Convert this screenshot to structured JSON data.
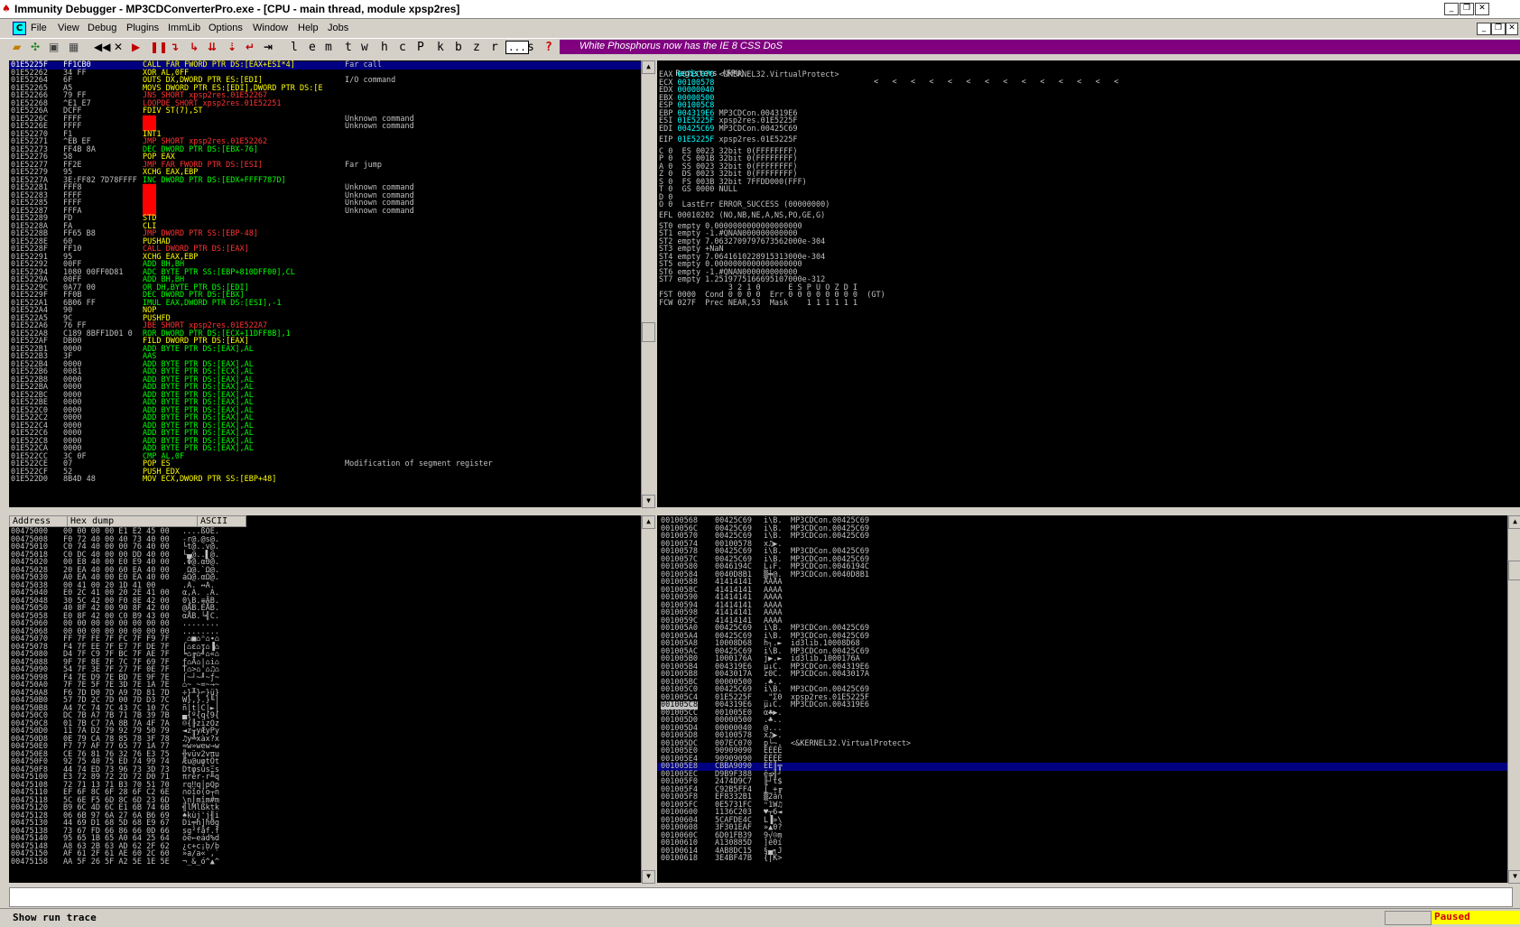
{
  "window": {
    "title": "Immunity Debugger - MP3CDConverterPro.exe - [CPU - main thread, module xpsp2res]"
  },
  "menu": [
    "File",
    "View",
    "Debug",
    "Plugins",
    "ImmLib",
    "Options",
    "Window",
    "Help",
    "Jobs"
  ],
  "toolbar": {
    "letters": [
      "l",
      "e",
      "m",
      "t",
      "w",
      "h",
      "c",
      "P",
      "k",
      "b",
      "z",
      "r",
      "...",
      "s",
      "?"
    ],
    "banner": "White Phosphorus now has the IE 8 CSS DoS"
  },
  "disasm": {
    "rows": [
      [
        "01E5225F",
        "FF1CB0",
        "CALL FAR FWORD PTR DS:[EAX+ESI*4]",
        "Far call",
        "sel"
      ],
      [
        "01E52262",
        "34 FF",
        "XOR AL,0FF",
        "",
        ""
      ],
      [
        "01E52264",
        "6F",
        "OUTS DX,DWORD PTR ES:[EDI]",
        "I/O command",
        ""
      ],
      [
        "01E52265",
        "A5",
        "MOVS DWORD PTR ES:[EDI],DWORD PTR DS:[E",
        "",
        ""
      ],
      [
        "01E52266",
        "79 FF",
        "JNS SHORT xpsp2res.01E52267",
        "",
        "j"
      ],
      [
        "01E52268",
        "^E1 E7",
        "LOOPDE SHORT xpsp2res.01E52251",
        "",
        "j"
      ],
      [
        "01E5226A",
        "DCFF",
        "FDIV ST(7),ST",
        "",
        ""
      ],
      [
        "01E5226C",
        "FFFF",
        "???",
        "Unknown command",
        "u"
      ],
      [
        "01E5226E",
        "FFFF",
        "???",
        "Unknown command",
        "u"
      ],
      [
        "01E52270",
        "F1",
        "INT1",
        "",
        ""
      ],
      [
        "01E52271",
        "^EB EF",
        "JMP SHORT xpsp2res.01E52262",
        "",
        "j"
      ],
      [
        "01E52273",
        "FF4B 8A",
        "DEC DWORD PTR DS:[EBX-76]",
        "",
        ""
      ],
      [
        "01E52276",
        "58",
        "POP EAX",
        "",
        ""
      ],
      [
        "01E52277",
        "FF2E",
        "JMP FAR FWORD PTR DS:[ESI]",
        "Far jump",
        "j"
      ],
      [
        "01E52279",
        "95",
        "XCHG EAX,EBP",
        "",
        ""
      ],
      [
        "01E5227A",
        "3E:FF82 7D78FFFF",
        "INC DWORD PTR DS:[EDX+FFFF787D]",
        "",
        ""
      ],
      [
        "01E52281",
        "FFF8",
        "???",
        "Unknown command",
        "u"
      ],
      [
        "01E52283",
        "FFFF",
        "???",
        "Unknown command",
        "u"
      ],
      [
        "01E52285",
        "FFFF",
        "???",
        "Unknown command",
        "u"
      ],
      [
        "01E52287",
        "FFFA",
        "???",
        "Unknown command",
        "u"
      ],
      [
        "01E52289",
        "FD",
        "STD",
        "",
        ""
      ],
      [
        "01E5228A",
        "FA",
        "CLI",
        "",
        ""
      ],
      [
        "01E5228B",
        "FF65 B8",
        "JMP DWORD PTR SS:[EBP-48]",
        "",
        "j"
      ],
      [
        "01E5228E",
        "60",
        "PUSHAD",
        "",
        ""
      ],
      [
        "01E5228F",
        "FF10",
        "CALL DWORD PTR DS:[EAX]",
        "",
        "c"
      ],
      [
        "01E52291",
        "95",
        "XCHG EAX,EBP",
        "",
        ""
      ],
      [
        "01E52292",
        "00FF",
        "ADD BH,BH",
        "",
        ""
      ],
      [
        "01E52294",
        "1080 00FF0D81",
        "ADC BYTE PTR SS:[EBP+810DFF00],CL",
        "",
        ""
      ],
      [
        "01E5229A",
        "00FF",
        "ADD BH,BH",
        "",
        ""
      ],
      [
        "01E5229C",
        "0A77 00",
        "OR DH,BYTE PTR DS:[EDI]",
        "",
        ""
      ],
      [
        "01E5229F",
        "FF0B",
        "DEC DWORD PTR DS:[EBX]",
        "",
        ""
      ],
      [
        "01E522A1",
        "6B06 FF",
        "IMUL EAX,DWORD PTR DS:[ESI],-1",
        "",
        ""
      ],
      [
        "01E522A4",
        "90",
        "NOP",
        "",
        ""
      ],
      [
        "01E522A5",
        "9C",
        "PUSHFD",
        "",
        ""
      ],
      [
        "01E522A6",
        "76 FF",
        "JBE SHORT xpsp2res.01E522A7",
        "",
        "j"
      ],
      [
        "01E522A8",
        "C189 8BFF1D01 0",
        "ROR DWORD PTR DS:[ECX+11DFF8B],1",
        "",
        ""
      ],
      [
        "01E522AF",
        "DB00",
        "FILD DWORD PTR DS:[EAX]",
        "",
        ""
      ],
      [
        "01E522B1",
        "0000",
        "ADD BYTE PTR DS:[EAX],AL",
        "",
        ""
      ],
      [
        "01E522B3",
        "3F",
        "AAS",
        "",
        ""
      ],
      [
        "01E522B4",
        "0000",
        "ADD BYTE PTR DS:[EAX],AL",
        "",
        ""
      ],
      [
        "01E522B6",
        "0081",
        "ADD BYTE PTR DS:[ECX],AL",
        "",
        ""
      ],
      [
        "01E522B8",
        "0000",
        "ADD BYTE PTR DS:[EAX],AL",
        "",
        ""
      ],
      [
        "01E522BA",
        "0000",
        "ADD BYTE PTR DS:[EAX],AL",
        "",
        ""
      ],
      [
        "01E522BC",
        "0000",
        "ADD BYTE PTR DS:[EAX],AL",
        "",
        ""
      ],
      [
        "01E522BE",
        "0000",
        "ADD BYTE PTR DS:[EAX],AL",
        "",
        ""
      ],
      [
        "01E522C0",
        "0000",
        "ADD BYTE PTR DS:[EAX],AL",
        "",
        ""
      ],
      [
        "01E522C2",
        "0000",
        "ADD BYTE PTR DS:[EAX],AL",
        "",
        ""
      ],
      [
        "01E522C4",
        "0000",
        "ADD BYTE PTR DS:[EAX],AL",
        "",
        ""
      ],
      [
        "01E522C6",
        "0000",
        "ADD BYTE PTR DS:[EAX],AL",
        "",
        ""
      ],
      [
        "01E522C8",
        "0000",
        "ADD BYTE PTR DS:[EAX],AL",
        "",
        ""
      ],
      [
        "01E522CA",
        "0000",
        "ADD BYTE PTR DS:[EAX],AL",
        "",
        ""
      ],
      [
        "01E522CC",
        "3C 0F",
        "CMP AL,0F",
        "",
        ""
      ],
      [
        "01E522CE",
        "07",
        "POP ES",
        "Modification of segment register",
        ""
      ],
      [
        "01E522CF",
        "52",
        "PUSH EDX",
        "",
        ""
      ],
      [
        "01E522D0",
        "8B4D 48",
        "MOV ECX,DWORD PTR SS:[EBP+48]",
        "",
        ""
      ]
    ]
  },
  "registers": {
    "header": "Registers (FPU)",
    "lines": [
      [
        "EAX",
        "007EC070",
        "<&KERNEL32.VirtualProtect>"
      ],
      [
        "ECX",
        "00100578",
        ""
      ],
      [
        "EDX",
        "00000040",
        ""
      ],
      [
        "EBX",
        "00000500",
        ""
      ],
      [
        "ESP",
        "001005C8",
        ""
      ],
      [
        "EBP",
        "004319E6",
        "MP3CDCon.004319E6"
      ],
      [
        "ESI",
        "01E5225F",
        "xpsp2res.01E5225F"
      ],
      [
        "EDI",
        "00425C69",
        "MP3CDCon.00425C69"
      ],
      [
        "",
        "",
        " "
      ],
      [
        "EIP",
        "01E5225F",
        "xpsp2res.01E5225F"
      ]
    ],
    "flags": [
      "C 0  ES 0023 32bit 0(FFFFFFFF)",
      "P 0  CS 001B 32bit 0(FFFFFFFF)",
      "A 0  SS 0023 32bit 0(FFFFFFFF)",
      "Z 0  DS 0023 32bit 0(FFFFFFFF)",
      "S 0  FS 003B 32bit 7FFDD000(FFF)",
      "T 0  GS 0000 NULL",
      "D 0",
      "O 0  LastErr ERROR_SUCCESS (00000000)"
    ],
    "efl": "EFL 00010202 (NO,NB,NE,A,NS,PO,GE,G)",
    "fpu": [
      "ST0 empty 0.0000000000000000000",
      "ST1 empty -1.#QNAN000000000000",
      "ST2 empty 7.0632709797673562000e-304",
      "ST3 empty +NaN",
      "ST4 empty 7.0641610228915313000e-304",
      "ST5 empty 0.0000000000000000000",
      "ST6 empty -1.#QNAN000000000000",
      "ST7 empty 1.2519775166695107000e-312",
      "               3 2 1 0      E S P U O Z D I",
      "FST 0000  Cond 0 0 0 0  Err 0 0 0 0 0 0 0 0  (GT)",
      "FCW 027F  Prec NEAR,53  Mask    1 1 1 1 1 1"
    ]
  },
  "dump": {
    "headers": [
      "Address",
      "Hex dump",
      "ASCII"
    ],
    "rows": [
      [
        "00475000",
        "00 00 00 00 E1 E2 45 00",
        "....ßÔE."
      ],
      [
        "00475008",
        "F0 72 40 00 40 73 40 00",
        "-r@.@s@."
      ],
      [
        "00475010",
        "C0 74 40 00 00 76 40 00",
        "└t@..v@."
      ],
      [
        "00475018",
        "C0 DC 40 00 00 DD 40 00",
        "└▄@..▌@."
      ],
      [
        "00475020",
        "00 E8 40 00 E0 E9 40 00",
        ".Φ@.αΘ@."
      ],
      [
        "00475028",
        "20 EA 40 00 60 EA 40 00",
        " Ω@.`Ω@."
      ],
      [
        "00475030",
        "A0 EA 40 00 E0 EA 40 00",
        "áΩ@.αΩ@."
      ],
      [
        "00475038",
        "00 41 00 20 1D 41 00",
        ".A. ↔A."
      ],
      [
        "00475040",
        "E0 2C 41 00 20 2E 41 00",
        "α,A. .A."
      ],
      [
        "00475048",
        "30 5C 42 00 F0 8E 42 00",
        "0\\B.≡ÄB."
      ],
      [
        "00475050",
        "40 8F 42 00 90 8F 42 00",
        "@ÅB.ÉÅB."
      ],
      [
        "00475058",
        "E0 8F 42 00 C0 B9 43 00",
        "αÅB.└╣C."
      ],
      [
        "00475060",
        "00 00 00 00 00 00 00 00",
        "........"
      ],
      [
        "00475068",
        "00 00 00 00 00 00 00 00",
        "........"
      ],
      [
        "00475070",
        "FF 7F FE 7F FC 7F F9 7F",
        " ⌂■⌂ⁿ⌂∙⌂"
      ],
      [
        "00475078",
        "F4 7F EE 7F E7 7F DE 7F",
        "⌠⌂ε⌂τ⌂▐⌂"
      ],
      [
        "00475080",
        "D4 7F C9 7F BC 7F AE 7F",
        "╘⌂╔⌂╝⌂«⌂"
      ],
      [
        "00475088",
        "9F 7F 8E 7F 7C 7F 69 7F",
        "ƒ⌂Ä⌂|⌂i⌂"
      ],
      [
        "00475090",
        "54 7F 3E 7F 27 7F 0E 7F",
        "T⌂>⌂'⌂♫⌂"
      ],
      [
        "00475098",
        "F4 7E D9 7E BD 7E 9F 7E",
        "⌠~┘~╜~ƒ~"
      ],
      [
        "004750A0",
        "7F 7E 5F 7E 3D 7E 1A 7E",
        "⌂~_~=~→~"
      ],
      [
        "004750A8",
        "F6 7D D0 7D A9 7D 81 7D",
        "÷}╨}⌐}ü}"
      ],
      [
        "004750B0",
        "57 7D 2C 7D 00 7D D3 7C",
        "W},}.}╙|"
      ],
      [
        "004750B8",
        "A4 7C 74 7C 43 7C 10 7C",
        "ñ|t|C|►|"
      ],
      [
        "004750C0",
        "DC 7B A7 7B 71 7B 39 7B",
        "▄{º{q{9{"
      ],
      [
        "004750C8",
        "01 7B C7 7A 8B 7A 4F 7A",
        "☺{╟zïzOz"
      ],
      [
        "004750D0",
        "11 7A D2 79 92 79 50 79",
        "◄z╥yÆyPy"
      ],
      [
        "004750D8",
        "0E 79 CA 78 85 78 3F 78",
        "♫y╩xàx?x"
      ],
      [
        "004750E0",
        "F7 77 AF 77 65 77 1A 77",
        "≈w»wew→w"
      ],
      [
        "004750E8",
        "CE 76 81 76 32 76 E3 75",
        "╬vüv2vπu"
      ],
      [
        "004750F0",
        "92 75 40 75 ED 74 99 74",
        "Æu@uφtÖt"
      ],
      [
        "004750F8",
        "44 74 ED 73 96 73 3D 73",
        "DtφsûsΞs"
      ],
      [
        "00475100",
        "E3 72 89 72 2D 72 D0 71",
        "πrër-r╨q"
      ],
      [
        "00475108",
        "72 71 13 71 B3 70 51 70",
        "rq‼q│pQp"
      ],
      [
        "00475110",
        "EF 6F 8C 6F 28 6F C2 6E",
        "∩oîo(o┬n"
      ],
      [
        "00475118",
        "5C 6E F5 6D 8C 6D 23 6D",
        "\\n⌡mîm#m"
      ],
      [
        "00475120",
        "B9 6C 4D 6C E1 6B 74 6B",
        "╣lMlßktk"
      ],
      [
        "00475128",
        "06 6B 97 6A 27 6A B6 69",
        "♠kùj'j╢i"
      ],
      [
        "00475130",
        "44 69 D1 68 5D 68 E9 67",
        "Di╤h]hΘg"
      ],
      [
        "00475138",
        "73 67 FD 66 86 66 0D 66",
        "sg²fåf.f"
      ],
      [
        "00475140",
        "95 65 1B 65 A0 64 25 64",
        "òe←eád%d"
      ],
      [
        "00475148",
        "A8 63 2B 63 AD 62 2F 62",
        "¿c+c¡b/b"
      ],
      [
        "00475150",
        "AF 61 2F 61 AE 60 2C 60",
        "»a/a«`,`"
      ],
      [
        "00475158",
        "AA 5F 26 5F A2 5E 1E 5E",
        "¬_&_ó^▲^"
      ]
    ]
  },
  "stack": {
    "rows": [
      [
        "00100568",
        "00425C69",
        "i\\B.",
        "MP3CDCon.00425C69",
        ""
      ],
      [
        "0010056C",
        "00425C69",
        "i\\B.",
        "MP3CDCon.00425C69",
        ""
      ],
      [
        "00100570",
        "00425C69",
        "i\\B.",
        "MP3CDCon.00425C69",
        ""
      ],
      [
        "00100574",
        "00100578",
        "x♫▶.",
        "",
        ""
      ],
      [
        "00100578",
        "00425C69",
        "i\\B.",
        "MP3CDCon.00425C69",
        ""
      ],
      [
        "0010057C",
        "00425C69",
        "i\\B.",
        "MP3CDCon.00425C69",
        ""
      ],
      [
        "00100580",
        "0046194C",
        "L↓F.",
        "MP3CDCon.0046194C",
        ""
      ],
      [
        "00100584",
        "0040D8B1",
        "▒╪@.",
        "MP3CDCon.0040D8B1",
        ""
      ],
      [
        "00100588",
        "41414141",
        "AAAA",
        "",
        ""
      ],
      [
        "0010058C",
        "41414141",
        "AAAA",
        "",
        ""
      ],
      [
        "00100590",
        "41414141",
        "AAAA",
        "",
        ""
      ],
      [
        "00100594",
        "41414141",
        "AAAA",
        "",
        ""
      ],
      [
        "00100598",
        "41414141",
        "AAAA",
        "",
        ""
      ],
      [
        "0010059C",
        "41414141",
        "AAAA",
        "",
        ""
      ],
      [
        "001005A0",
        "00425C69",
        "i\\B.",
        "MP3CDCon.00425C69",
        ""
      ],
      [
        "001005A4",
        "00425C69",
        "i\\B.",
        "MP3CDCon.00425C69",
        ""
      ],
      [
        "001005A8",
        "10008D68",
        "h┐.►",
        "id3lib.10008D68",
        ""
      ],
      [
        "001005AC",
        "00425C69",
        "i\\B.",
        "MP3CDCon.00425C69",
        ""
      ],
      [
        "001005B0",
        "1000176A",
        "j▶.►",
        "id3lib.1000176A",
        ""
      ],
      [
        "001005B4",
        "004319E6",
        "µ↓C.",
        "MP3CDCon.004319E6",
        ""
      ],
      [
        "001005B8",
        "0043017A",
        "z0C.",
        "MP3CDCon.0043017A",
        ""
      ],
      [
        "001005BC",
        "00000500",
        ".♣..",
        "",
        ""
      ],
      [
        "001005C0",
        "00425C69",
        "i\\B.",
        "MP3CDCon.00425C69",
        ""
      ],
      [
        "001005C4",
        "01E5225F",
        "_\"Σ0",
        "xpsp2res.01E5225F",
        ""
      ],
      [
        "001005C8",
        "004319E6",
        "µ↓C.",
        "MP3CDCon.004319E6",
        "cur"
      ],
      [
        "001005CC",
        "001005E0",
        "α♣▶.",
        "",
        ""
      ],
      [
        "001005D0",
        "00000500",
        ".♣..",
        "",
        ""
      ],
      [
        "001005D4",
        "00000040",
        "@...",
        "",
        ""
      ],
      [
        "001005D8",
        "00100578",
        "x♫▶.",
        "",
        ""
      ],
      [
        "001005DC",
        "007EC070",
        "p└~.",
        "<&KERNEL32.VirtualProtect>",
        ""
      ],
      [
        "001005E0",
        "90909090",
        "ÉÉÉÉ",
        "",
        ""
      ],
      [
        "001005E4",
        "90909090",
        "ÉÉÉÉ",
        "",
        ""
      ],
      [
        "001005E8",
        "CBBA9090",
        "ÉÉ║╦",
        "",
        "sel"
      ],
      [
        "001005EC",
        "D9B9F388",
        "ê≤╣┘",
        "",
        ""
      ],
      [
        "001005F0",
        "2474D9C7",
        "╟┘t$",
        "",
        ""
      ],
      [
        "001005F4",
        "C92B5FF4",
        "⌠_+╔",
        "",
        ""
      ],
      [
        "001005F8",
        "EF8332B1",
        "▒2â∩",
        "",
        ""
      ],
      [
        "001005FC",
        "0E5731FC",
        "ⁿ1W♫",
        "",
        ""
      ],
      [
        "00100600",
        "1136C203",
        "♥┬6◄",
        "",
        ""
      ],
      [
        "00100604",
        "5CAFDE4C",
        "L▐»\\",
        "",
        ""
      ],
      [
        "00100608",
        "3F301EAF",
        "»▲0?",
        "",
        ""
      ],
      [
        "0010060C",
        "6D01FB39",
        "9√☺m",
        "",
        ""
      ],
      [
        "00100610",
        "A130885D",
        "]ê0í",
        "",
        ""
      ],
      [
        "00100614",
        "4AB8DC15",
        "§▄╕J",
        "",
        ""
      ],
      [
        "00100618",
        "3E4BF47B",
        "{⌠K>",
        "",
        ""
      ]
    ]
  },
  "statusbar": {
    "text": "Show run trace",
    "state": "Paused"
  }
}
